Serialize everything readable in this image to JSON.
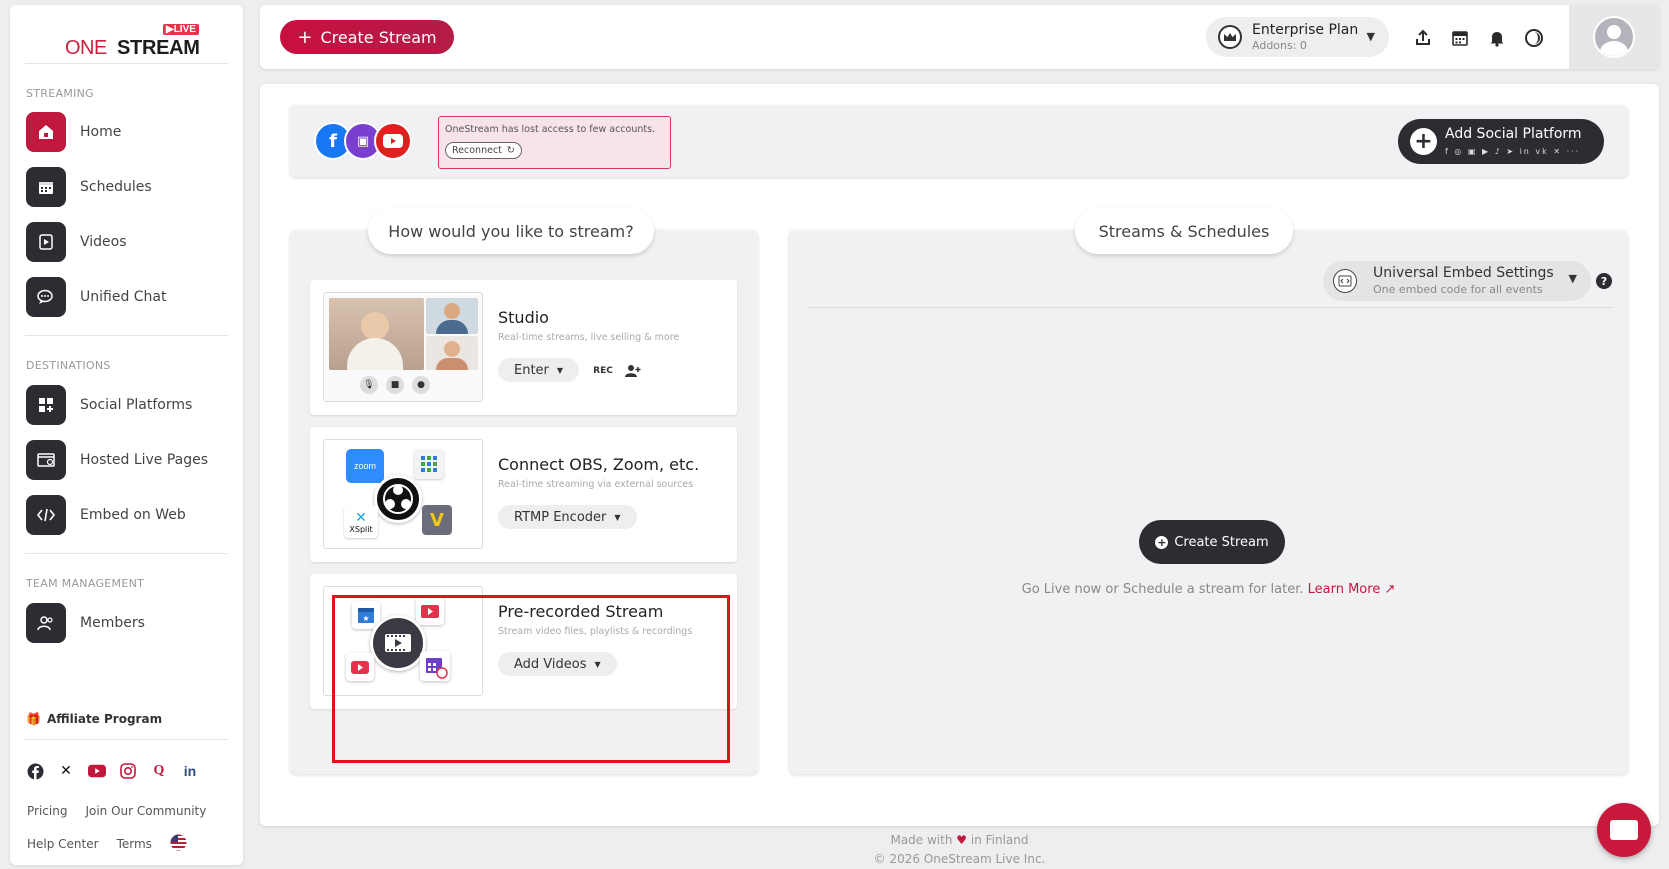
{
  "sidebar": {
    "logo": {
      "one": "ONE",
      "stream": "STREAM",
      "live": "▶LIVE"
    },
    "sections": {
      "streaming": "STREAMING",
      "destinations": "DESTINATIONS",
      "team": "TEAM MANAGEMENT"
    },
    "items": [
      {
        "label": "Home",
        "icon": "home-icon"
      },
      {
        "label": "Schedules",
        "icon": "calendar-icon"
      },
      {
        "label": "Videos",
        "icon": "video-file-icon"
      },
      {
        "label": "Unified Chat",
        "icon": "chat-icon"
      },
      {
        "label": "Social Platforms",
        "icon": "grid-plus-icon"
      },
      {
        "label": "Hosted Live Pages",
        "icon": "web-page-icon"
      },
      {
        "label": "Embed on Web",
        "icon": "code-icon"
      },
      {
        "label": "Members",
        "icon": "members-icon"
      }
    ],
    "affiliate": "Affiliate Program",
    "footer": {
      "pricing": "Pricing",
      "community": "Join Our Community",
      "help": "Help Center",
      "terms": "Terms"
    }
  },
  "topbar": {
    "create_stream": "Create Stream",
    "plan_name": "Enterprise Plan",
    "plan_addons": "Addons: 0"
  },
  "destinations": {
    "warning": "OneStream has lost access to few accounts.",
    "reconnect": "Reconnect",
    "add_social": "Add Social Platform",
    "mini_icons": "f ◎ ▣ ▶ ♪ ➤ in vk ✕ ···"
  },
  "left": {
    "heading": "How would you like to stream?",
    "cards": [
      {
        "title": "Studio",
        "subtitle": "Real-time streams, live selling & more",
        "button": "Enter",
        "rec": "REC"
      },
      {
        "title": "Connect OBS, Zoom, etc.",
        "subtitle": "Real-time streaming via external sources",
        "button": "RTMP Encoder",
        "zoom": "zoom",
        "xsplit": "XSplit"
      },
      {
        "title": "Pre-recorded Stream",
        "subtitle": "Stream video files, playlists & recordings",
        "button": "Add Videos"
      }
    ]
  },
  "right": {
    "heading": "Streams & Schedules",
    "embed_title": "Universal Embed Settings",
    "embed_sub": "One embed code for all events",
    "create_stream": "Create Stream",
    "empty_text": "Go Live now or Schedule a stream for later.",
    "learn_more": "Learn More"
  },
  "footer": {
    "made_with_prefix": "Made with",
    "heart": "♥",
    "made_with_suffix": "in Finland",
    "copyright": "© 2026 OneStream Live Inc."
  },
  "colors": {
    "brand": "#c1183e",
    "dark": "#2c2d33",
    "highlight": "#d9141a"
  }
}
